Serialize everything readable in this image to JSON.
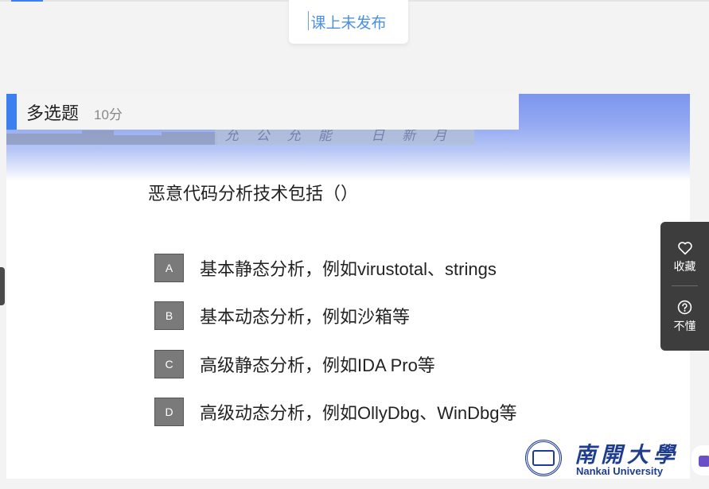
{
  "status_pill": {
    "label": "课上未发布"
  },
  "question_header": {
    "type_label": "多选题",
    "score_label": "10分"
  },
  "banner": {
    "motto": "允公允能 日新月异"
  },
  "question": {
    "text": "恶意代码分析技术包括（）"
  },
  "options": [
    {
      "letter": "A",
      "text": "基本静态分析，例如virustotal、strings"
    },
    {
      "letter": "B",
      "text": "基本动态分析，例如沙箱等"
    },
    {
      "letter": "C",
      "text": "高级静态分析，例如IDA Pro等"
    },
    {
      "letter": "D",
      "text": "高级动态分析，例如OllyDbg、WinDbg等"
    }
  ],
  "logo": {
    "cn": "南開大學",
    "en": "Nankai University"
  },
  "side_panel": {
    "favorite_label": "收藏",
    "favorite_icon": "heart-icon",
    "confused_label": "不懂",
    "confused_icon": "question-circle-icon"
  },
  "colors": {
    "accent": "#3b7ff0",
    "status_text": "#4a90e2",
    "option_box": "#7a7a7a",
    "side_panel": "#3d3d3d",
    "logo": "#1e3d8f"
  }
}
